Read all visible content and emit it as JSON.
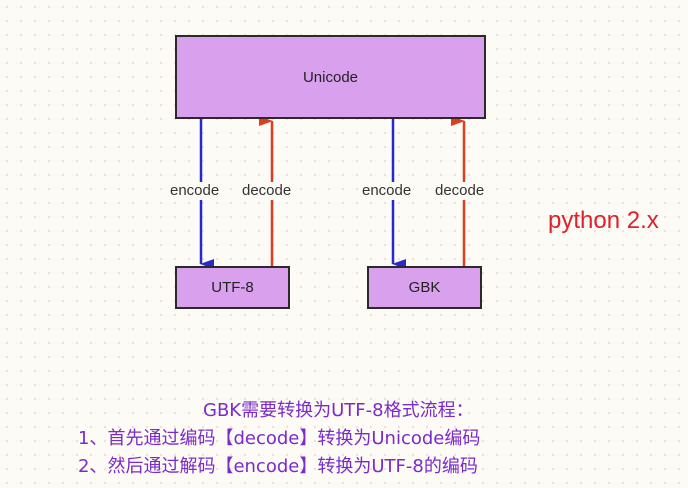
{
  "diagram": {
    "unicode_label": "Unicode",
    "utf8_label": "UTF-8",
    "gbk_label": "GBK",
    "encode_label": "encode",
    "decode_label": "decode",
    "version_label": "python 2.x"
  },
  "notes": {
    "title": "GBK需要转换为UTF-8格式流程：",
    "line1": "1、首先通过编码【decode】转换为Unicode编码",
    "line2": "2、然后通过解码【encode】转换为UTF-8的编码"
  },
  "colors": {
    "box_fill": "#d9a0ee",
    "encode_arrow": "#2a28c8",
    "decode_arrow": "#e23c1e",
    "version_text": "#e0202a",
    "note_text": "#7b2bc9"
  }
}
